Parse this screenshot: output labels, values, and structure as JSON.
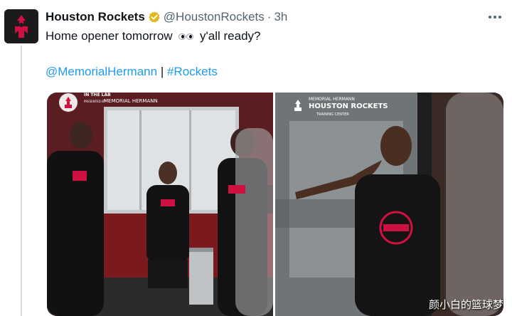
{
  "tweet": {
    "author": {
      "display_name": "Houston Rockets",
      "handle": "@HoustonRockets",
      "separator": "·",
      "time": "3h"
    },
    "text_before": "Home opener tomorrow",
    "text_after": "y'all ready?",
    "mention": "@MemorialHermann",
    "tag_separator": "|",
    "hashtag": "#Rockets"
  },
  "media": {
    "photo1": {
      "overlay_title": "IN THE LAB",
      "overlay_presented": "PRESENTED BY",
      "overlay_sponsor": "MEMORIAL HERMANN"
    },
    "photo2": {
      "overlay_sponsor": "MEMORIAL HERMANN",
      "overlay_brand": "HOUSTON ROCKETS",
      "overlay_sub": "TRAINING CENTER"
    },
    "watermark": "颜小白的篮球梦"
  },
  "colors": {
    "link": "#1d9bf0",
    "secondary_text": "#536471",
    "verified": "#e2b719",
    "rockets_red": "#ce1141"
  },
  "icons": {
    "verified": "verified-badge-icon",
    "more": "more-options-icon",
    "eyes": "eyes-emoji-icon"
  }
}
